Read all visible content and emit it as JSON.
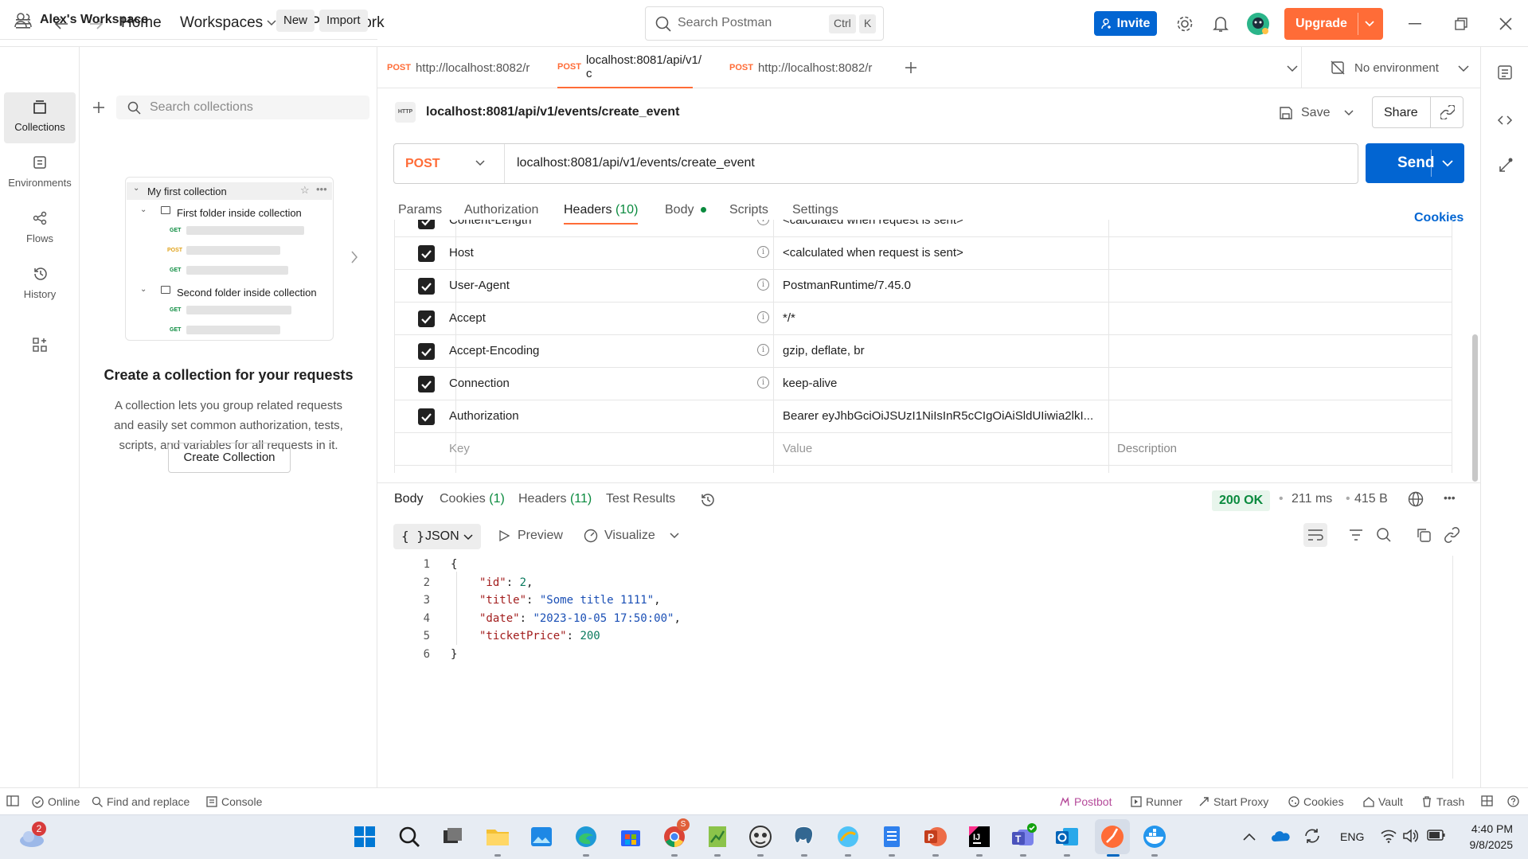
{
  "topbar": {
    "nav": [
      "Home",
      "Workspaces",
      "API Network"
    ],
    "search_placeholder": "Search Postman",
    "kbd": [
      "Ctrl",
      "K"
    ],
    "invite": "Invite",
    "upgrade": "Upgrade"
  },
  "sidebar": {
    "workspace": "Alex's Workspace",
    "new": "New",
    "import": "Import",
    "rail": [
      {
        "label": "Collections",
        "icon": "collections-icon"
      },
      {
        "label": "Environments",
        "icon": "environments-icon"
      },
      {
        "label": "Flows",
        "icon": "flows-icon"
      },
      {
        "label": "History",
        "icon": "history-icon"
      }
    ],
    "search_placeholder": "Search collections",
    "illustration": {
      "collection": "My first collection",
      "folder1": "First folder inside collection",
      "folder2": "Second folder inside collection",
      "methods1": [
        "GET",
        "POST",
        "GET"
      ],
      "methods2": [
        "GET",
        "GET"
      ]
    },
    "empty_title": "Create a collection for your requests",
    "empty_desc": "A collection lets you group related requests and easily set common authorization, tests, scripts, and variables for all requests in it.",
    "create_btn": "Create Collection"
  },
  "tabs": [
    {
      "method": "POST",
      "label": "http://localhost:8082/r"
    },
    {
      "method": "POST",
      "label": "localhost:8081/api/v1/с"
    },
    {
      "method": "POST",
      "label": "http://localhost:8082/r"
    }
  ],
  "environment": "No environment",
  "request": {
    "http_badge": "HTTP",
    "name": "localhost:8081/api/v1/events/create_event",
    "save": "Save",
    "share": "Share",
    "method": "POST",
    "url": "localhost:8081/api/v1/events/create_event",
    "send": "Send",
    "tabs": [
      "Params",
      "Authorization",
      "Headers",
      "(10)",
      "Body",
      "Scripts",
      "Settings"
    ],
    "cookies": "Cookies"
  },
  "headers": [
    {
      "key": "Content-Length",
      "value": "<calculated when request is sent>"
    },
    {
      "key": "Host",
      "value": "<calculated when request is sent>"
    },
    {
      "key": "User-Agent",
      "value": "PostmanRuntime/7.45.0"
    },
    {
      "key": "Accept",
      "value": "*/*"
    },
    {
      "key": "Accept-Encoding",
      "value": "gzip, deflate, br"
    },
    {
      "key": "Connection",
      "value": "keep-alive"
    },
    {
      "key": "Authorization",
      "value": "Bearer eyJhbGciOiJSUzI1NiIsInR5cCIgOiAiSldUIiwia2lkI..."
    }
  ],
  "headers_placeholder": {
    "key": "Key",
    "value": "Value",
    "description": "Description"
  },
  "response": {
    "tabs": {
      "body": "Body",
      "cookies": "Cookies",
      "cookies_count": "(1)",
      "headers": "Headers",
      "headers_count": "(11)",
      "tests": "Test Results"
    },
    "status": "200 OK",
    "time": "211 ms",
    "size": "415 B",
    "format": "JSON",
    "preview": "Preview",
    "visualize": "Visualize",
    "lines": [
      "1",
      "2",
      "3",
      "4",
      "5",
      "6"
    ],
    "json": {
      "open": "{",
      "k1": "\"id\"",
      "v1": "2",
      "k2": "\"title\"",
      "v2": "\"Some title 1111\"",
      "k3": "\"date\"",
      "v3": "\"2023-10-05 17:50:00\"",
      "k4": "\"ticketPrice\"",
      "v4": "200",
      "close": "}"
    }
  },
  "statusbar": {
    "online": "Online",
    "find": "Find and replace",
    "console": "Console",
    "postbot": "Postbot",
    "runner": "Runner",
    "proxy": "Start Proxy",
    "cookies": "Cookies",
    "vault": "Vault",
    "trash": "Trash"
  },
  "taskbar": {
    "weather_badge": "2",
    "chrome_badge": "S",
    "lang": "ENG",
    "time": "4:40 PM",
    "date": "9/8/2025"
  },
  "colors": {
    "accent": "#ff6c37",
    "primary": "#0265d2",
    "success": "#0a8a3e"
  }
}
